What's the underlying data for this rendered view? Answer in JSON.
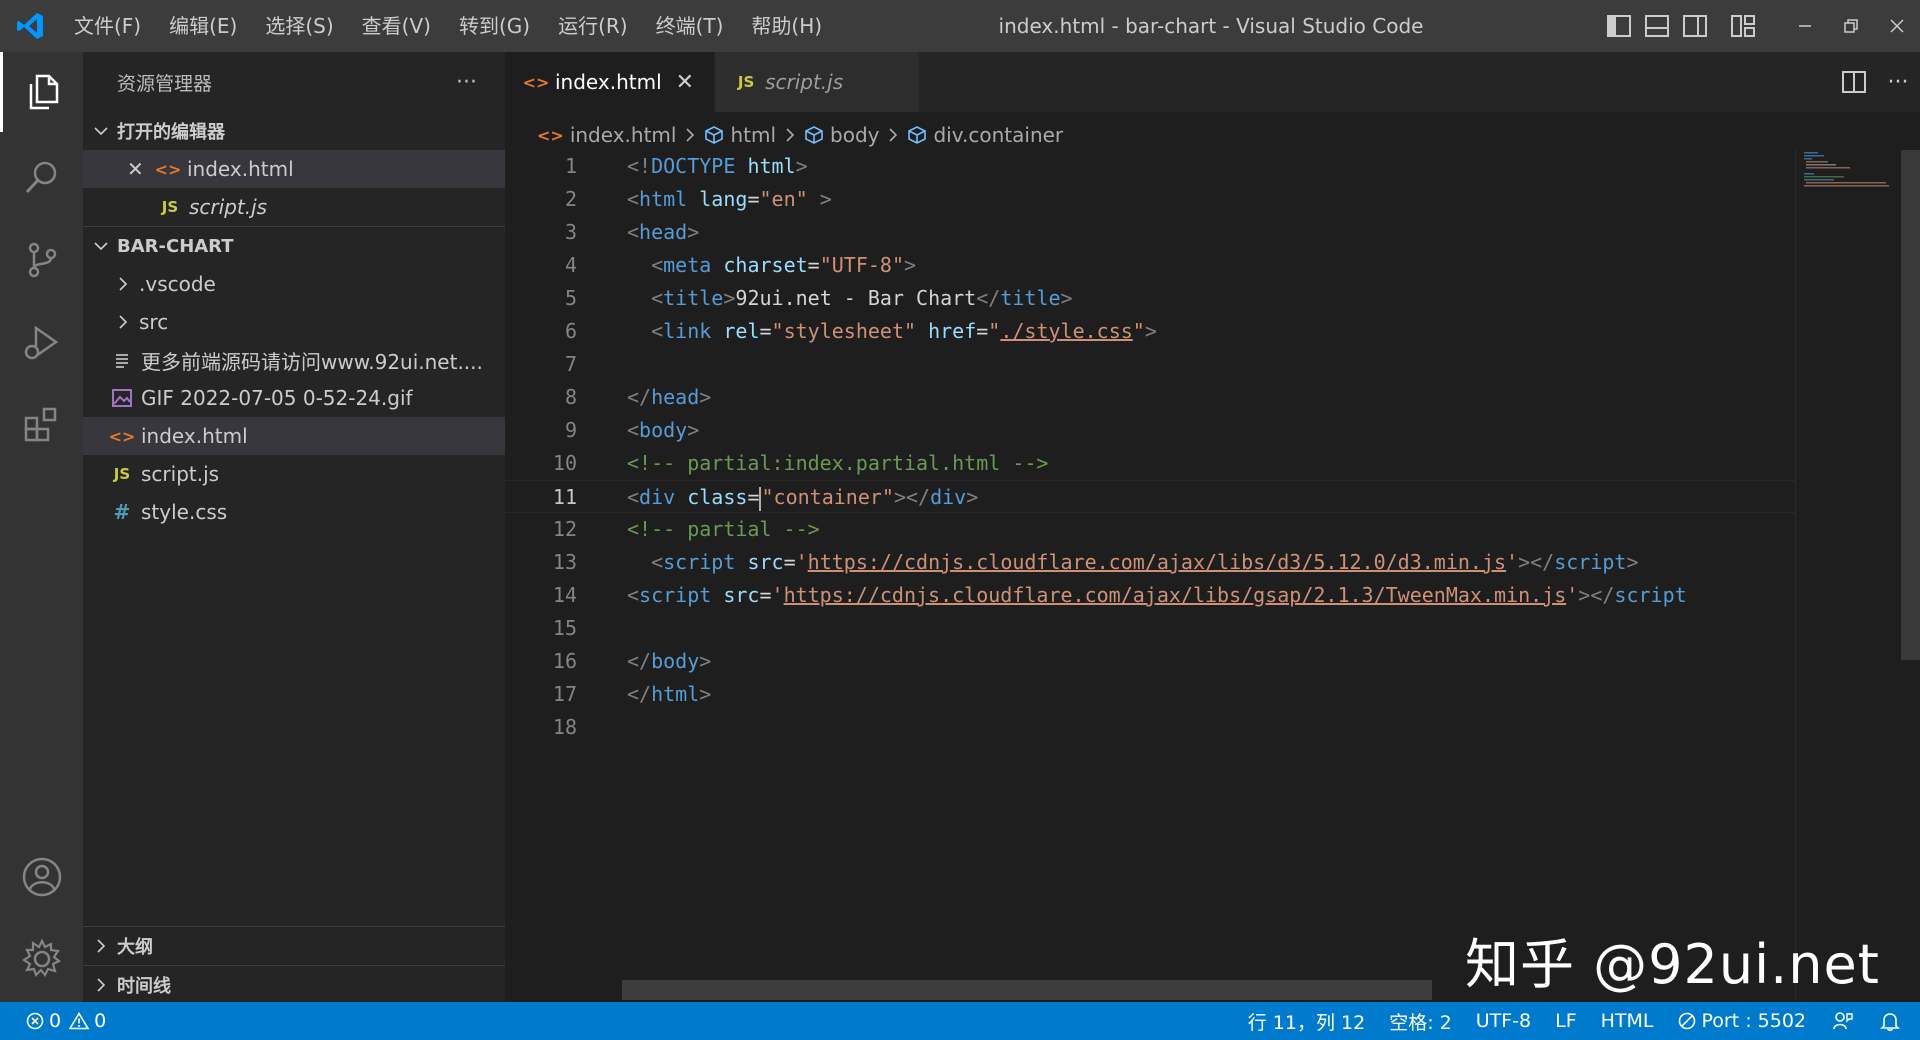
{
  "window": {
    "title": "index.html - bar-chart - Visual Studio Code",
    "menu": [
      "文件(F)",
      "编辑(E)",
      "选择(S)",
      "查看(V)",
      "转到(G)",
      "运行(R)",
      "终端(T)",
      "帮助(H)"
    ]
  },
  "explorer": {
    "header": "资源管理器",
    "more": "···",
    "open_editors_title": "打开的编辑器",
    "open_editors": [
      {
        "name": "index.html",
        "icon": "html-file-icon",
        "close": "✕"
      },
      {
        "name": "script.js",
        "icon": "js-file-icon"
      }
    ],
    "project_title": "BAR-CHART",
    "tree": [
      {
        "name": ".vscode",
        "type": "folder"
      },
      {
        "name": "src",
        "type": "folder"
      },
      {
        "name": "更多前端源码请访问www.92ui.net....",
        "type": "text-file"
      },
      {
        "name": "GIF 2022-07-05 0-52-24.gif",
        "type": "image-file"
      },
      {
        "name": "index.html",
        "type": "html-file"
      },
      {
        "name": "script.js",
        "type": "js-file"
      },
      {
        "name": "style.css",
        "type": "css-file"
      }
    ],
    "outline_title": "大纲",
    "timeline_title": "时间线"
  },
  "tabs": [
    {
      "label": "index.html",
      "active": true,
      "close": "✕"
    },
    {
      "label": "script.js",
      "active": false
    }
  ],
  "icons": {
    "js_badge": "JS",
    "css_badge": "#",
    "html_badge": "<>"
  },
  "breadcrumb": [
    "index.html",
    "html",
    "body",
    "div.container"
  ],
  "code": {
    "current_line": 11,
    "line_numbers": [
      "1",
      "2",
      "3",
      "4",
      "5",
      "6",
      "7",
      "8",
      "9",
      "10",
      "11",
      "12",
      "13",
      "14",
      "15",
      "16",
      "17",
      "18"
    ],
    "l1": {
      "p1": "<!",
      "kw": "DOCTYPE",
      "sp": " ",
      "t": "html",
      "p2": ">"
    },
    "l2": {
      "p1": "<",
      "tag": "html",
      "sp": " ",
      "attr": "lang",
      "eq": "=",
      "val": "\"en\"",
      "p2": " >"
    },
    "l3": {
      "p1": "<",
      "tag": "head",
      "p2": ">"
    },
    "l4": {
      "ind": "  ",
      "p1": "<",
      "tag": "meta",
      "sp": " ",
      "attr": "charset",
      "eq": "=",
      "val": "\"UTF-8\"",
      "p2": ">"
    },
    "l5": {
      "ind": "  ",
      "p1": "<",
      "tag": "title",
      "p2": ">",
      "text": "92ui.net - Bar Chart",
      "p3": "</",
      "tag2": "title",
      "p4": ">"
    },
    "l6": {
      "ind": "  ",
      "p1": "<",
      "tag": "link",
      "sp": " ",
      "attr": "rel",
      "eq": "=",
      "val": "\"stylesheet\"",
      "sp2": " ",
      "attr2": "href",
      "eq2": "=",
      "q1": "\"",
      "link": "./style.css",
      "q2": "\"",
      "p2": ">"
    },
    "l8": {
      "p1": "</",
      "tag": "head",
      "p2": ">"
    },
    "l9": {
      "p1": "<",
      "tag": "body",
      "p2": ">"
    },
    "l10": {
      "comment": "<!-- partial:index.partial.html -->"
    },
    "l11": {
      "p1": "<",
      "tag": "div",
      "sp": " ",
      "attr": "class",
      "eq": "=",
      "val": "\"container\"",
      "p2": "></",
      "tag2": "div",
      "p3": ">"
    },
    "l12": {
      "comment": "<!-- partial -->"
    },
    "l13": {
      "ind": "  ",
      "p1": "<",
      "tag": "script",
      "sp": " ",
      "attr": "src",
      "eq": "=",
      "q1": "'",
      "link": "https://cdnjs.cloudflare.com/ajax/libs/d3/5.12.0/d3.min.js",
      "q2": "'",
      "p2": "></",
      "tag2": "script",
      "p3": ">"
    },
    "l14": {
      "p1": "<",
      "tag": "script",
      "sp": " ",
      "attr": "src",
      "eq": "=",
      "q1": "'",
      "link": "https://cdnjs.cloudflare.com/ajax/libs/gsap/2.1.3/TweenMax.min.js",
      "q2": "'",
      "p2": "></",
      "tag2": "script"
    },
    "l16": {
      "p1": "</",
      "tag": "body",
      "p2": ">"
    },
    "l17": {
      "p1": "</",
      "tag": "html",
      "p2": ">"
    }
  },
  "watermark": "知乎 @92ui.net",
  "status": {
    "errors": "0",
    "warnings": "0",
    "position": "行 11，列 12",
    "spaces": "空格: 2",
    "encoding": "UTF-8",
    "eol": "LF",
    "language": "HTML",
    "port": "Port : 5502"
  },
  "colors": {
    "accent": "#007acc",
    "titlebar": "#3c3c3c",
    "activitybar": "#333333",
    "sidebar": "#252526",
    "editor": "#1e1e1e"
  }
}
